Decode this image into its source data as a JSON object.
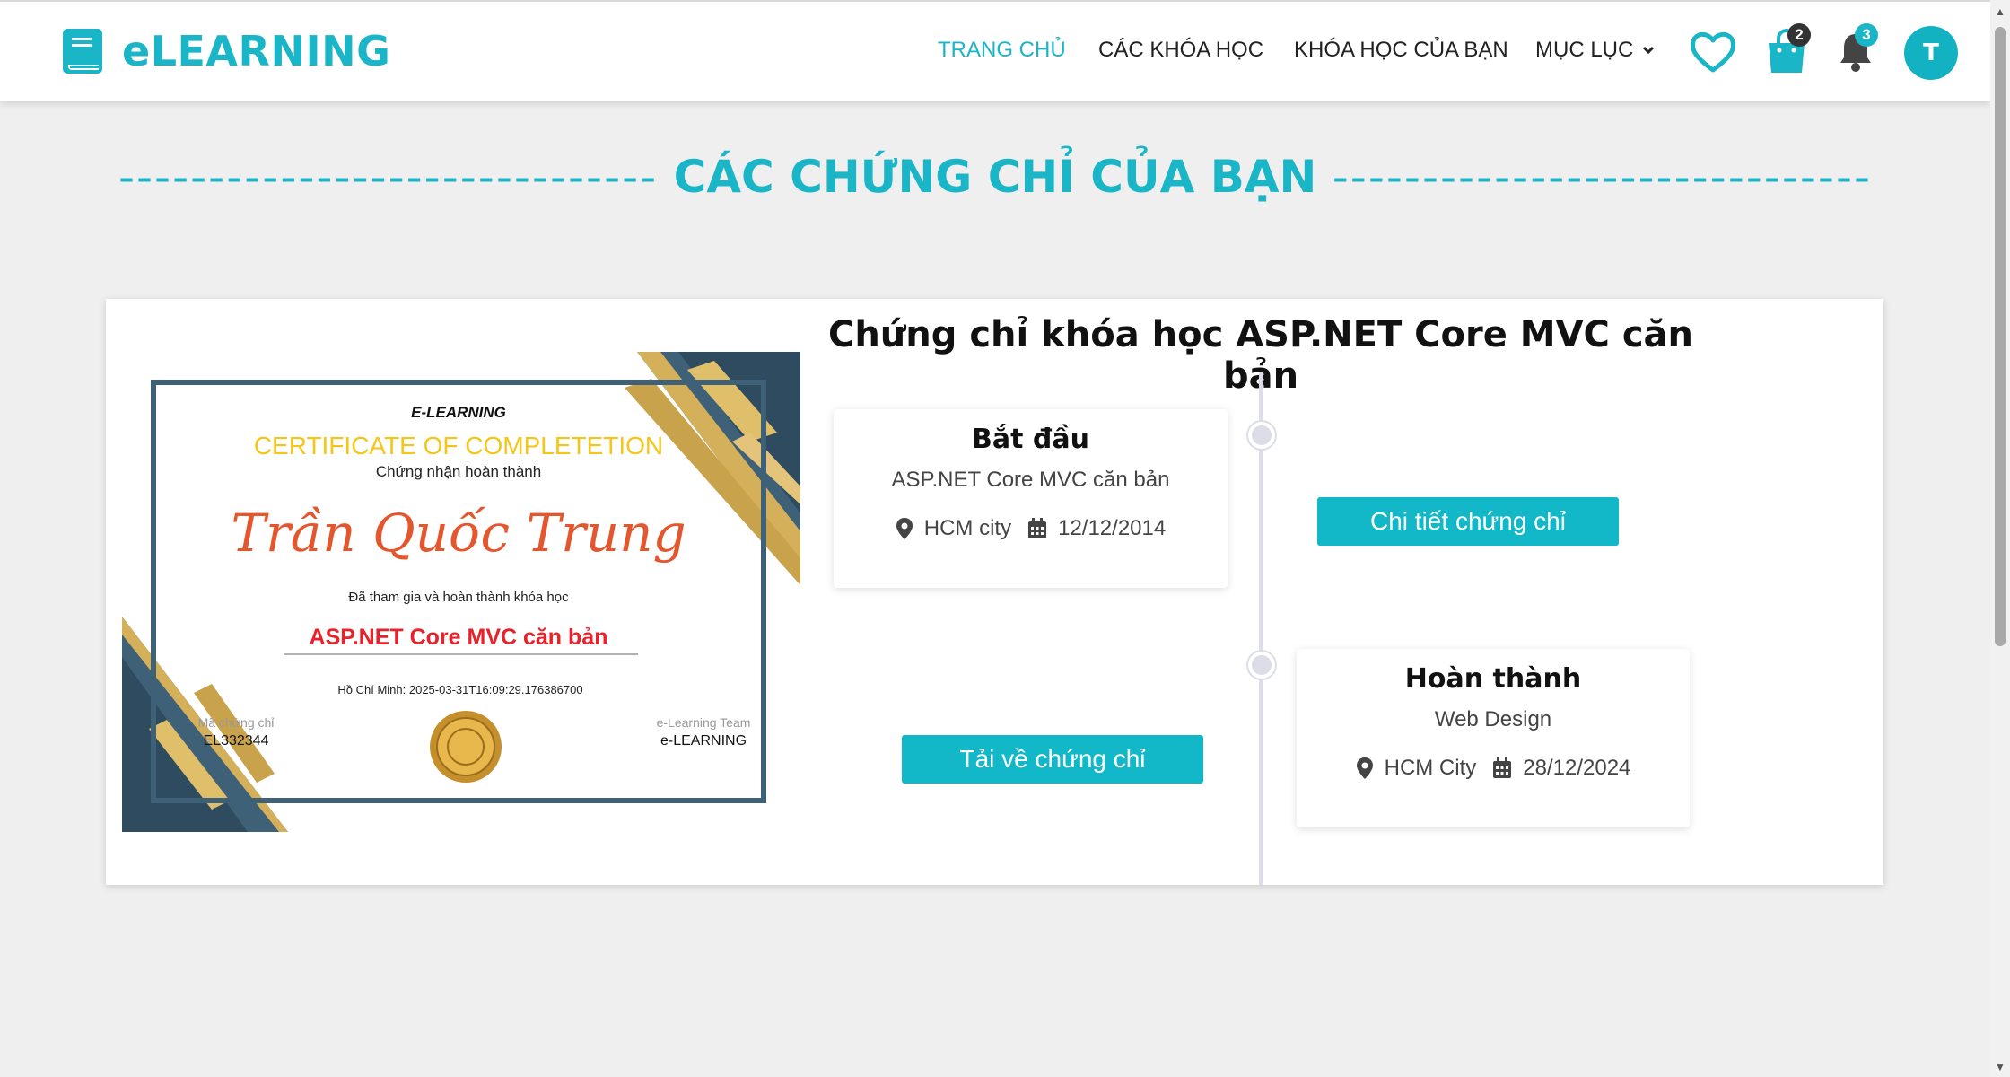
{
  "brand": {
    "name": "eLEARNING",
    "color": "#1ab6c8",
    "logo_icon": "book-icon"
  },
  "nav": {
    "home": "TRANG CHỦ",
    "courses": "CÁC KHÓA HỌC",
    "my_courses": "KHÓA HỌC CỦA BẠN",
    "menu": "MỤC LỤC"
  },
  "header_icons": {
    "wishlist": "heart-icon",
    "cart": "shopping-bag-icon",
    "cart_count": "2",
    "notifications": "bell-icon",
    "notification_count": "3",
    "avatar_initial": "T"
  },
  "page": {
    "dashes_left": "------------------------------",
    "title": "CÁC CHỨNG CHỈ CỦA BẠN",
    "dashes_right": "------------------------------"
  },
  "certificate": {
    "heading": "Chứng chỉ khóa học ASP.NET Core MVC căn bản",
    "image": {
      "brand": "E-LEARNING",
      "title": "CERTIFICATE OF COMPLETETION",
      "subtitle": "Chứng nhận hoàn thành",
      "recipient": "Trần Quốc Trung",
      "statement": "Đã tham gia và hoàn thành khóa học",
      "course": "ASP.NET Core MVC căn bản",
      "issued": "Hồ Chí Minh: 2025-03-31T16:09:29.176386700",
      "code_label": "Mã chứng chỉ",
      "code": "EL332344",
      "team_label": "e-Learning Team",
      "team": "e-LEARNING"
    },
    "start": {
      "heading": "Bắt đầu",
      "course": "ASP.NET Core MVC căn bản",
      "location": "HCM city",
      "date": "12/12/2014"
    },
    "finish": {
      "heading": "Hoàn thành",
      "course": "Web Design",
      "location": "HCM City",
      "date": "28/12/2024"
    },
    "detail_button": "Chi tiết chứng chỉ",
    "download_button": "Tải về chứng chỉ"
  },
  "colors": {
    "accent": "#1ab6c8",
    "button": "#12b7c8",
    "cert_title": "#f5c518",
    "recipient": "#e4572e",
    "course_red": "#e8212b"
  }
}
